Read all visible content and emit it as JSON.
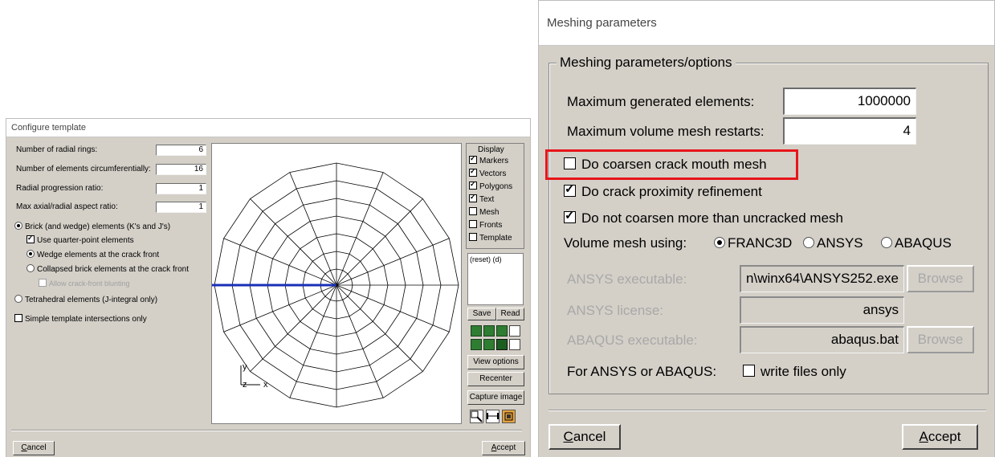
{
  "left_window": {
    "title": "Configure template",
    "fields": [
      {
        "label": "Number of radial rings:",
        "value": "6"
      },
      {
        "label": "Number of elements circumferentially:",
        "value": "16"
      },
      {
        "label": "Radial progression ratio:",
        "value": "1"
      },
      {
        "label": "Max axial/radial aspect ratio:",
        "value": "1"
      }
    ],
    "radio_brick": "Brick (and wedge) elements (K's and J's)",
    "check_quarter_point": "Use quarter-point elements",
    "radio_wedge": "Wedge elements at the crack front",
    "radio_collapsed": "Collapsed brick elements at the crack front",
    "check_blunting": "Allow crack-front blunting",
    "radio_tetra": "Tetrahedral elements (J-integral only)",
    "check_simple": "Simple template intersections only",
    "axis_y": "y",
    "axis_z": "z",
    "axis_x": "x",
    "display": {
      "title": "Display",
      "items": [
        {
          "label": "Markers",
          "checked": true
        },
        {
          "label": "Vectors",
          "checked": true
        },
        {
          "label": "Polygons",
          "checked": true
        },
        {
          "label": "Text",
          "checked": true
        },
        {
          "label": "Mesh",
          "checked": false
        },
        {
          "label": "Fronts",
          "checked": false
        },
        {
          "label": "Template",
          "checked": false
        }
      ]
    },
    "history_text": "(reset) (d)",
    "save_label": "Save",
    "read_label": "Read",
    "view_options_label": "View options",
    "recenter_label": "Recenter",
    "capture_label": "Capture image",
    "cancel_u": "C",
    "cancel_rest": "ancel",
    "accept_u": "A",
    "accept_rest": "ccept"
  },
  "right_window": {
    "title": "Meshing parameters",
    "group_title": "Meshing parameters/options",
    "max_elements_label": "Maximum generated elements:",
    "max_elements_value": "1000000",
    "max_restarts_label": "Maximum volume mesh restarts:",
    "max_restarts_value": "4",
    "coarsen_mouth_label": "Do coarsen crack mouth mesh",
    "proximity_label": "Do crack proximity refinement",
    "no_coarsen_label": "Do not coarsen more than uncracked mesh",
    "volume_mesh_label": "Volume mesh using:",
    "opt_franc3d": "FRANC3D",
    "opt_ansys": "ANSYS",
    "opt_abaqus": "ABAQUS",
    "ansys_exe_label": "ANSYS executable:",
    "ansys_exe_value": "n\\winx64\\ANSYS252.exe",
    "ansys_license_label": "ANSYS license:",
    "ansys_license_value": "ansys",
    "abaqus_exe_label": "ABAQUS executable:",
    "abaqus_exe_value": "abaqus.bat",
    "browse_label": "Browse",
    "for_ansys_label": "For ANSYS or ABAQUS:",
    "write_files_label": "write files only",
    "cancel_u": "C",
    "cancel_rest": "ancel",
    "accept_u": "A",
    "accept_rest": "ccept",
    "highlight_color": "#e8141a"
  }
}
